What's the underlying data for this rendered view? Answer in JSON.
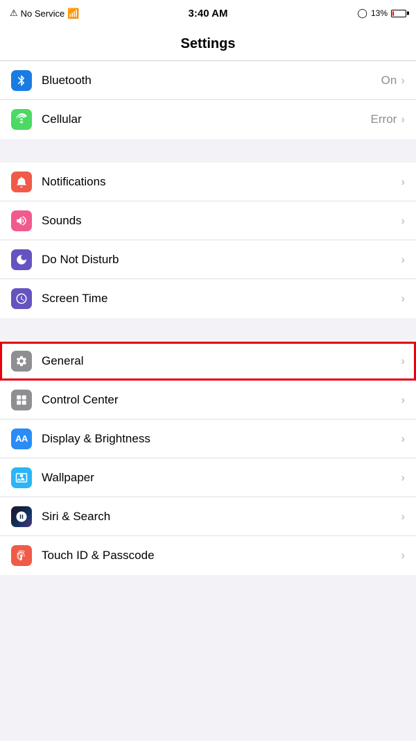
{
  "statusBar": {
    "left": "No Service",
    "center": "3:40 AM",
    "battery": "13%",
    "batteryFill": 13
  },
  "header": {
    "title": "Settings"
  },
  "sections": [
    {
      "id": "connectivity",
      "rows": [
        {
          "id": "bluetooth",
          "label": "Bluetooth",
          "value": "On",
          "icon": "bluetooth",
          "highlighted": false
        },
        {
          "id": "cellular",
          "label": "Cellular",
          "value": "Error",
          "icon": "cellular",
          "highlighted": false
        }
      ]
    },
    {
      "id": "system1",
      "rows": [
        {
          "id": "notifications",
          "label": "Notifications",
          "value": "",
          "icon": "notifications",
          "highlighted": false
        },
        {
          "id": "sounds",
          "label": "Sounds",
          "value": "",
          "icon": "sounds",
          "highlighted": false
        },
        {
          "id": "dnd",
          "label": "Do Not Disturb",
          "value": "",
          "icon": "dnd",
          "highlighted": false
        },
        {
          "id": "screentime",
          "label": "Screen Time",
          "value": "",
          "icon": "screentime",
          "highlighted": false
        }
      ]
    },
    {
      "id": "system2",
      "rows": [
        {
          "id": "general",
          "label": "General",
          "value": "",
          "icon": "general",
          "highlighted": true
        },
        {
          "id": "control",
          "label": "Control Center",
          "value": "",
          "icon": "control",
          "highlighted": false
        },
        {
          "id": "display",
          "label": "Display & Brightness",
          "value": "",
          "icon": "display",
          "highlighted": false
        },
        {
          "id": "wallpaper",
          "label": "Wallpaper",
          "value": "",
          "icon": "wallpaper",
          "highlighted": false
        },
        {
          "id": "siri",
          "label": "Siri & Search",
          "value": "",
          "icon": "siri",
          "highlighted": false
        },
        {
          "id": "touchid",
          "label": "Touch ID & Passcode",
          "value": "",
          "icon": "touchid",
          "highlighted": false
        }
      ]
    }
  ]
}
